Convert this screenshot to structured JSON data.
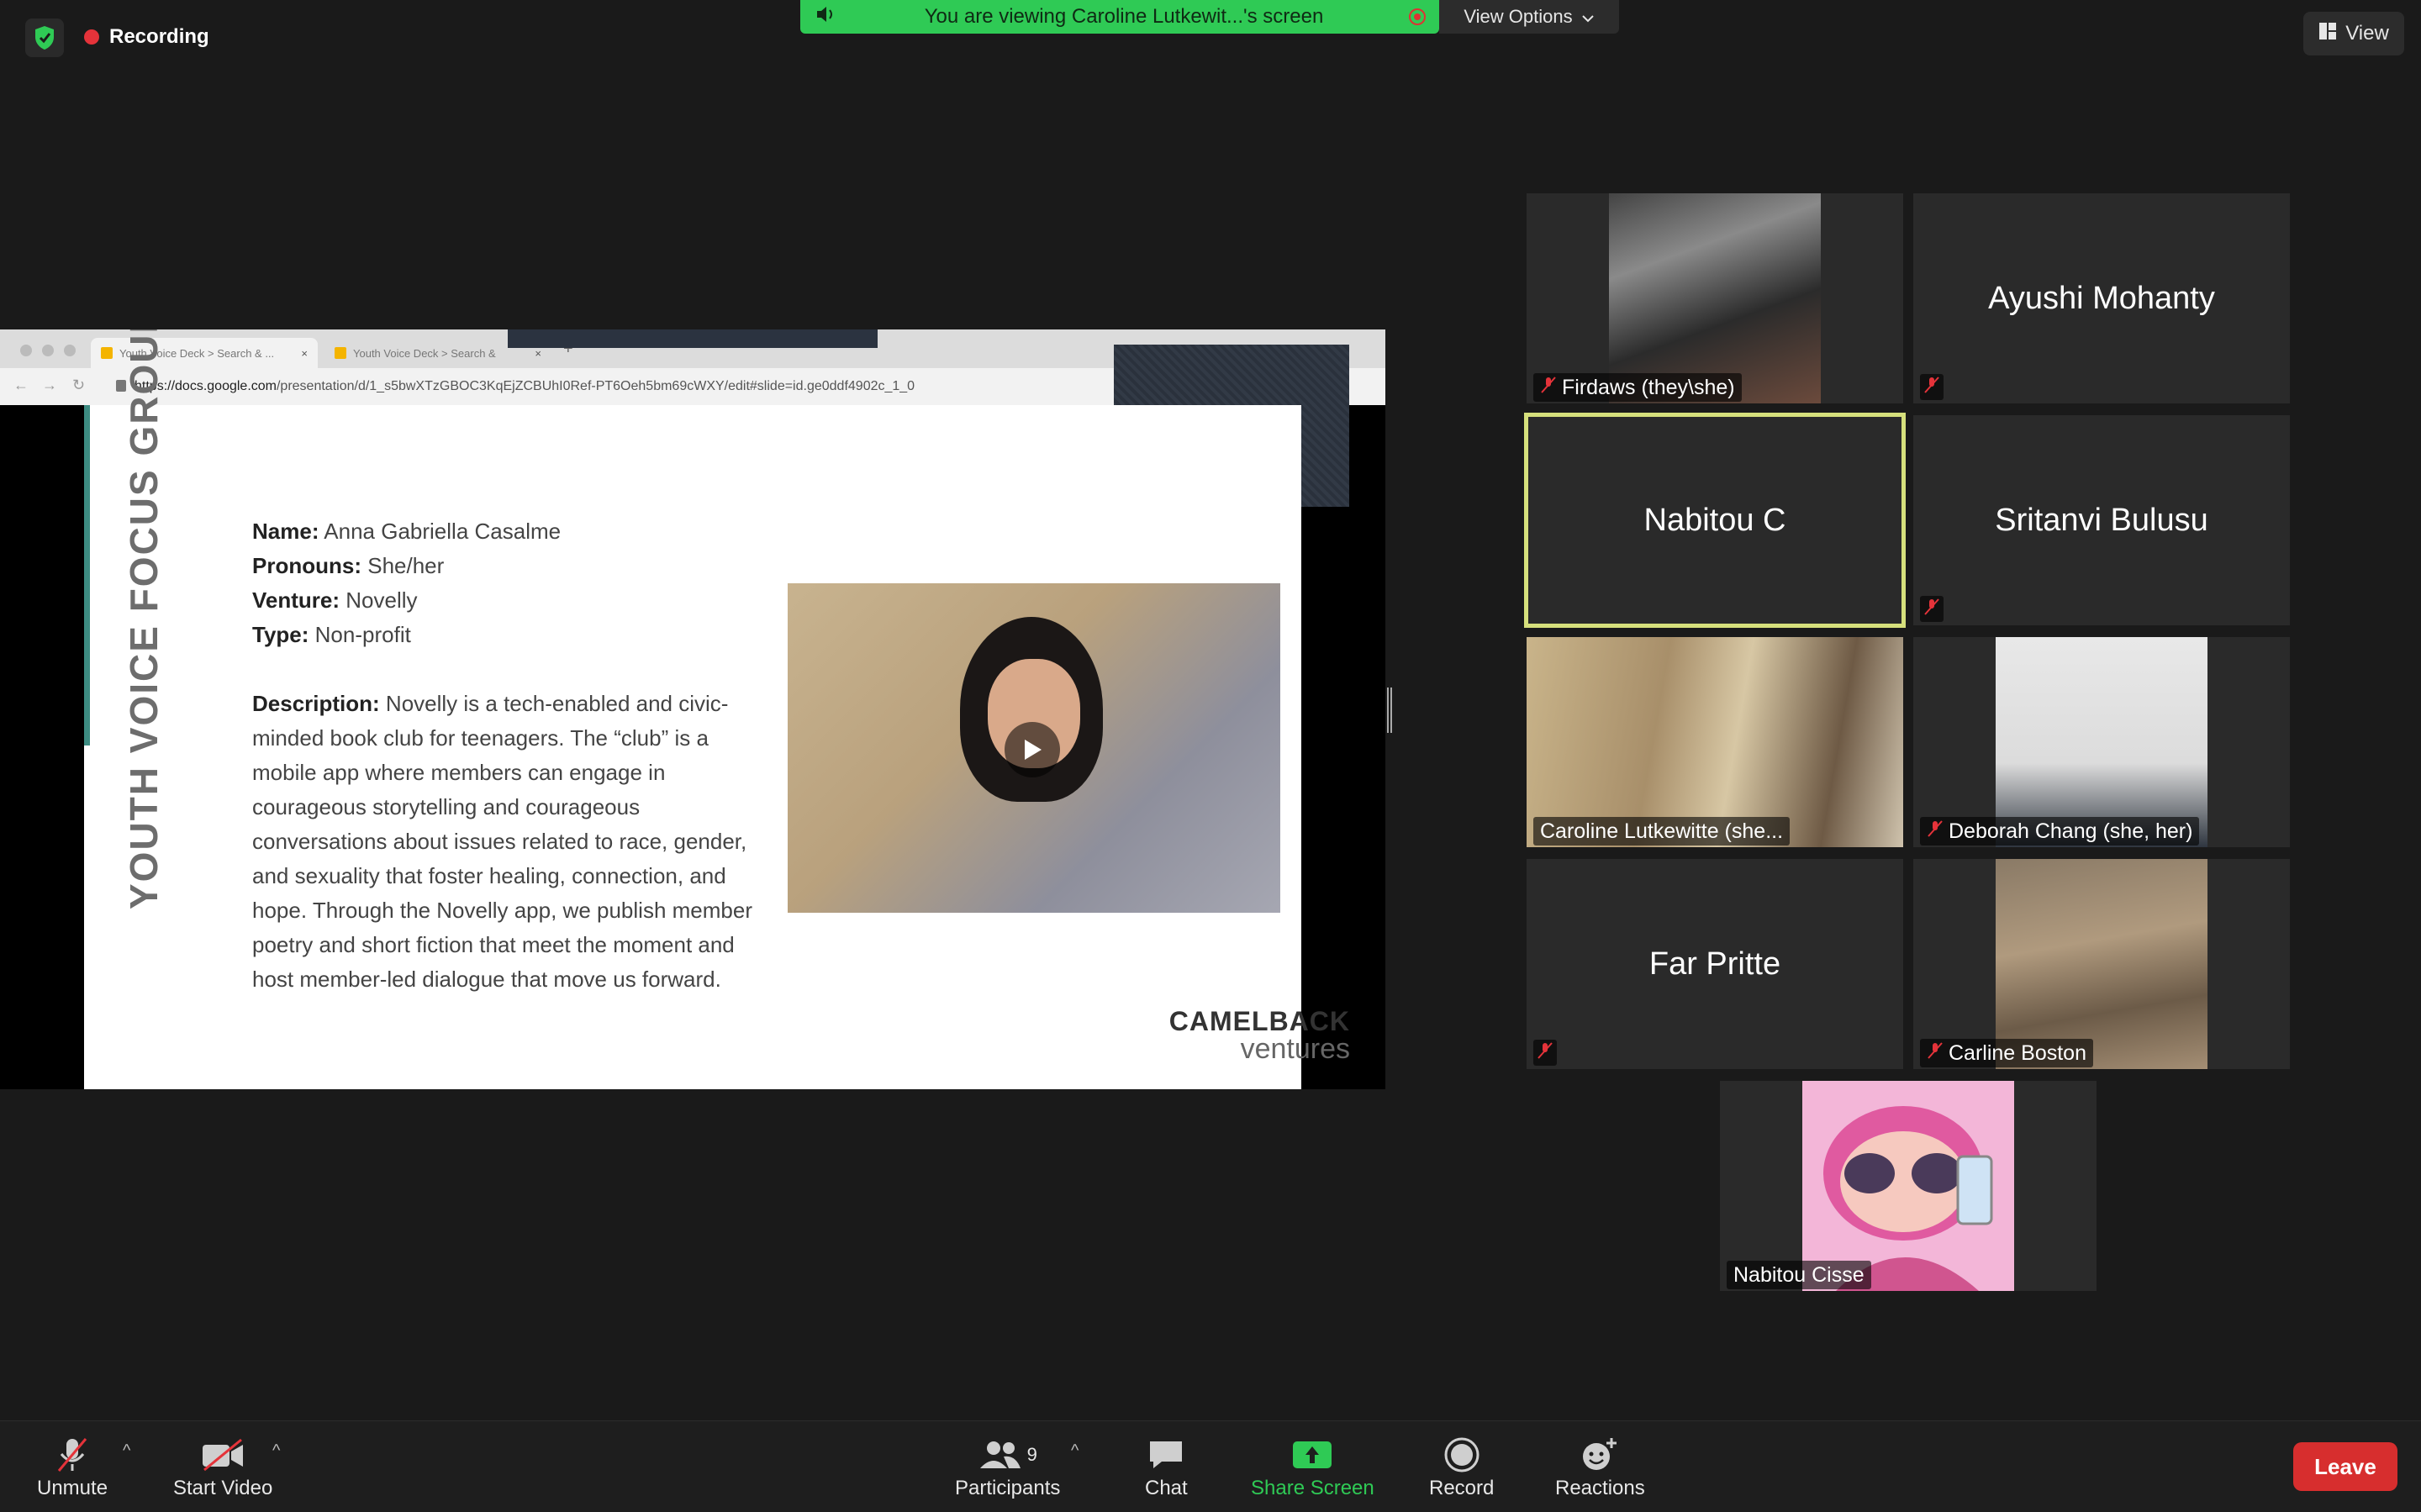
{
  "top": {
    "recording": "Recording",
    "banner": "You are viewing Caroline Lutkewit...'s screen",
    "view_options": "View Options",
    "view": "View"
  },
  "shared": {
    "tab1": "Youth Voice Deck > Search & ...",
    "tab2": "Youth Voice Deck > Search &",
    "url_host": "https://docs.google.com",
    "url_path": "/presentation/d/1_s5bwXTzGBOC3KqEjZCBUhI0Ref-PT6Oeh5bm69cWXY/edit#slide=id.ge0ddf4902c_1_0",
    "vertical_title": "YOUTH VOICE FOCUS GROUP",
    "name_label": "Name:",
    "name": "Anna Gabriella Casalme",
    "pronouns_label": "Pronouns:",
    "pronouns": "She/her",
    "venture_label": "Venture:",
    "venture": "Novelly",
    "type_label": "Type:",
    "type": "Non-profit",
    "description_label": "Description:",
    "description": "Novelly is a tech-enabled and civic-minded book club for teenagers. The “club” is a mobile app where members can engage in courageous storytelling and courageous conversations about issues related to race, gender, and sexuality that foster healing, connection, and hope. Through the Novelly app, we publish member poetry and short fiction that meet the moment and host member-led dialogue that move us forward.",
    "logo_line1": "CAMELBACK",
    "logo_line2": "ventures"
  },
  "participants": [
    {
      "name": "Firdaws (they\\she)",
      "muted": true
    },
    {
      "name": "Ayushi Mohanty",
      "muted": true
    },
    {
      "name": "Nabitou C",
      "muted": false
    },
    {
      "name": "Sritanvi Bulusu",
      "muted": true
    },
    {
      "name": "Caroline Lutkewitte (she...",
      "muted": false
    },
    {
      "name": "Deborah Chang (she, her)",
      "muted": true
    },
    {
      "name": "Far Pritte",
      "muted": true
    },
    {
      "name": "Carline Boston",
      "muted": true
    },
    {
      "name": "Nabitou Cisse",
      "muted": false
    }
  ],
  "toolbar": {
    "unmute": "Unmute",
    "start_video": "Start Video",
    "participants": "Participants",
    "participant_count": "9",
    "chat": "Chat",
    "share_screen": "Share Screen",
    "record": "Record",
    "reactions": "Reactions",
    "leave": "Leave"
  },
  "colors": {
    "banner_green": "#2fca55",
    "active_speaker": "#d6e07c",
    "leave_red": "#d72e2e",
    "mute_red": "#e5333a"
  }
}
